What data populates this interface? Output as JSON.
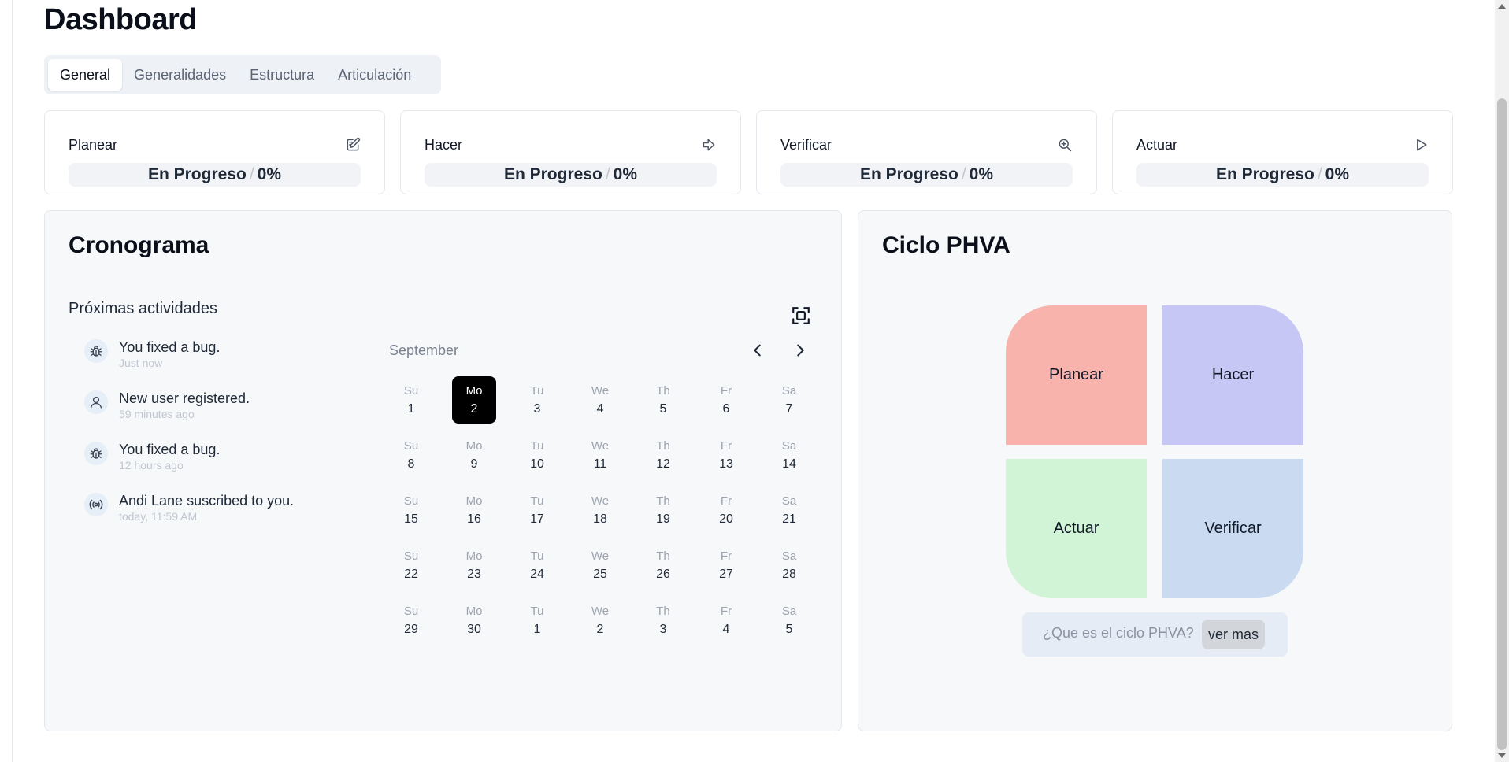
{
  "page_title": "Dashboard",
  "tabs": [
    {
      "label": "General"
    },
    {
      "label": "Generalidades"
    },
    {
      "label": "Estructura"
    },
    {
      "label": "Articulación"
    }
  ],
  "stats": [
    {
      "label": "Planear",
      "status": "En Progreso",
      "separator": "/",
      "percent": "0%",
      "icon": "edit-icon"
    },
    {
      "label": "Hacer",
      "status": "En Progreso",
      "separator": "/",
      "percent": "0%",
      "icon": "arrow-right-icon"
    },
    {
      "label": "Verificar",
      "status": "En Progreso",
      "separator": "/",
      "percent": "0%",
      "icon": "zoom-in-icon"
    },
    {
      "label": "Actuar",
      "status": "En Progreso",
      "separator": "/",
      "percent": "0%",
      "icon": "play-icon"
    }
  ],
  "cronograma": {
    "title": "Cronograma",
    "activities_label": "Próximas actividades",
    "activities": [
      {
        "text": "You fixed a bug.",
        "time": "Just now",
        "icon": "bug-icon"
      },
      {
        "text": "New user registered.",
        "time": "59 minutes ago",
        "icon": "user-icon"
      },
      {
        "text": "You fixed a bug.",
        "time": "12 hours ago",
        "icon": "bug-icon"
      },
      {
        "text": "Andi Lane suscribed to you.",
        "time": "today, 11:59 AM",
        "icon": "broadcast-icon"
      }
    ],
    "calendar": {
      "month": "September",
      "weekdays": [
        "Su",
        "Mo",
        "Tu",
        "We",
        "Th",
        "Fr",
        "Sa"
      ],
      "weeks": [
        [
          "1",
          "2",
          "3",
          "4",
          "5",
          "6",
          "7"
        ],
        [
          "8",
          "9",
          "10",
          "11",
          "12",
          "13",
          "14"
        ],
        [
          "15",
          "16",
          "17",
          "18",
          "19",
          "20",
          "21"
        ],
        [
          "22",
          "23",
          "24",
          "25",
          "26",
          "27",
          "28"
        ],
        [
          "29",
          "30",
          "1",
          "2",
          "3",
          "4",
          "5"
        ]
      ],
      "selected": "2"
    }
  },
  "phva": {
    "title": "Ciclo PHVA",
    "quadrants": {
      "planear": "Planear",
      "hacer": "Hacer",
      "actuar": "Actuar",
      "verificar": "Verificar"
    },
    "question": "¿Que es el ciclo PHVA?",
    "more_button": "ver mas",
    "colors": {
      "planear": "#f9b3ad",
      "hacer": "#c7c7f5",
      "actuar": "#d0f4d5",
      "verificar": "#c9daf1"
    }
  }
}
